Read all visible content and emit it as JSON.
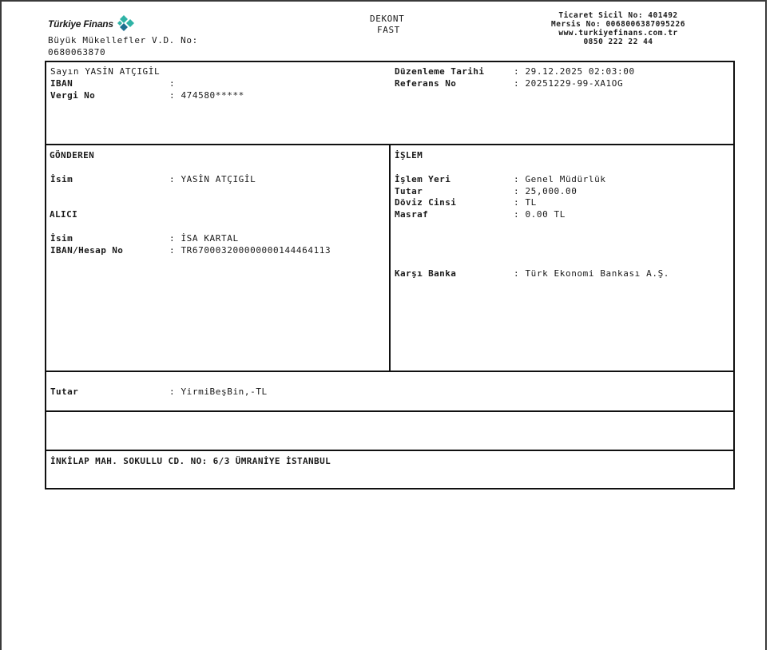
{
  "header": {
    "brand": "Türkiye Finans",
    "tax_office_label": "Büyük Mükellefler V.D. No:",
    "tax_office_no": "0680063870",
    "doc_title": "DEKONT",
    "doc_subtitle": "FAST",
    "trade_registry": "Ticaret Sicil No: 401492",
    "mersis": "Mersis No: 0068006387095226",
    "website": "www.turkiyefinans.com.tr",
    "phone": "0850 222 22 44",
    "logo_colors": [
      "#2fb3a6",
      "#1d6f8f"
    ]
  },
  "customer": {
    "greeting": "Sayın YASİN ATÇIGİL",
    "iban_label": "IBAN",
    "iban_value": ":",
    "tax_label": "Vergi No",
    "tax_value": ": 474580*****",
    "date_label": "Düzenleme Tarihi",
    "date_value": ": 29.12.2025 02:03:00",
    "ref_label": "Referans No",
    "ref_value": ": 20251229-99-XA1OG"
  },
  "sender": {
    "section_title": "GÖNDEREN",
    "name_label": "İsim",
    "name_value": ": YASİN ATÇIGİL"
  },
  "receiver": {
    "section_title": "ALICI",
    "name_label": "İsim",
    "name_value": ": İSA KARTAL",
    "iban_label": "IBAN/Hesap No",
    "iban_value": ": TR670003200000000144464113"
  },
  "transaction": {
    "section_title": "İŞLEM",
    "place_label": "İşlem Yeri",
    "place_value": ": Genel Müdürlük",
    "amount_label": "Tutar",
    "amount_value": ": 25,000.00",
    "currency_label": "Döviz Cinsi",
    "currency_value": ": TL",
    "fee_label": "Masraf",
    "fee_value": ": 0.00 TL",
    "bank_label": "Karşı Banka",
    "bank_value": ": Türk Ekonomi Bankası A.Ş."
  },
  "amount_words": {
    "label": "Tutar",
    "value": ": YirmiBeşBin,-TL"
  },
  "address": "İNKİLAP MAH. SOKULLU CD. NO: 6/3 ÜMRANİYE İSTANBUL"
}
